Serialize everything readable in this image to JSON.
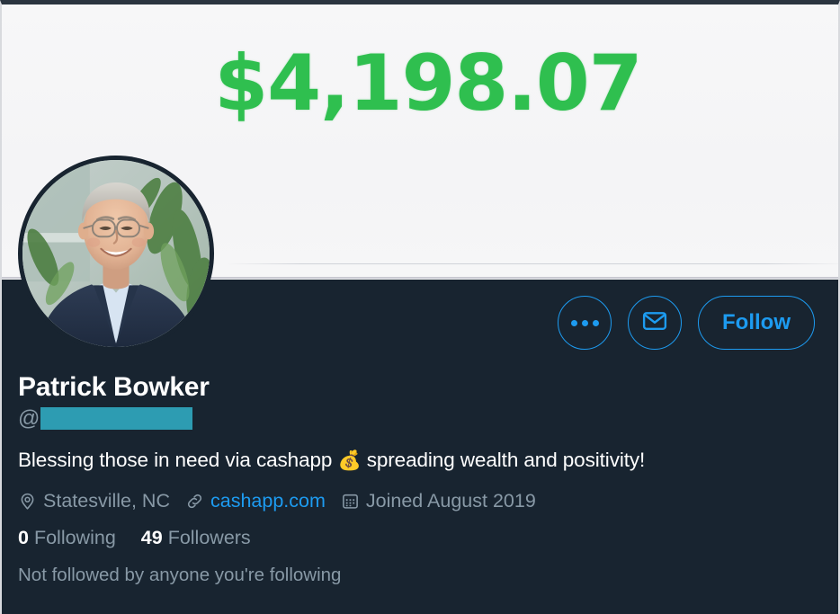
{
  "banner": {
    "amount": "$4,198.07",
    "amount_color": "#2FBF4F",
    "background_color": "#F5F5F7"
  },
  "theme": {
    "body_background": "#182430",
    "accent_blue": "#1D9BF0",
    "muted_text": "#8899A6",
    "primary_text": "#FFFFFF",
    "redaction_color": "#2D9CB2"
  },
  "actions": {
    "more_label": "More options",
    "message_label": "Message",
    "follow_label": "Follow"
  },
  "profile": {
    "display_name": "Patrick Bowker",
    "at_symbol": "@",
    "handle_redacted": true,
    "bio_before_emoji": "Blessing those in need via cashapp ",
    "bio_emoji": "💰",
    "bio_after_emoji": " spreading wealth and positivity!",
    "location": "Statesville, NC",
    "website": "cashapp.com",
    "joined": "Joined August 2019",
    "following_count": "0",
    "following_label": "Following",
    "followers_count": "49",
    "followers_label": "Followers",
    "followed_by_note": "Not followed by anyone you're following"
  },
  "icons": {
    "location": "location-pin-icon",
    "link": "link-icon",
    "calendar": "calendar-icon",
    "message": "envelope-icon",
    "more": "three-dots-icon"
  }
}
